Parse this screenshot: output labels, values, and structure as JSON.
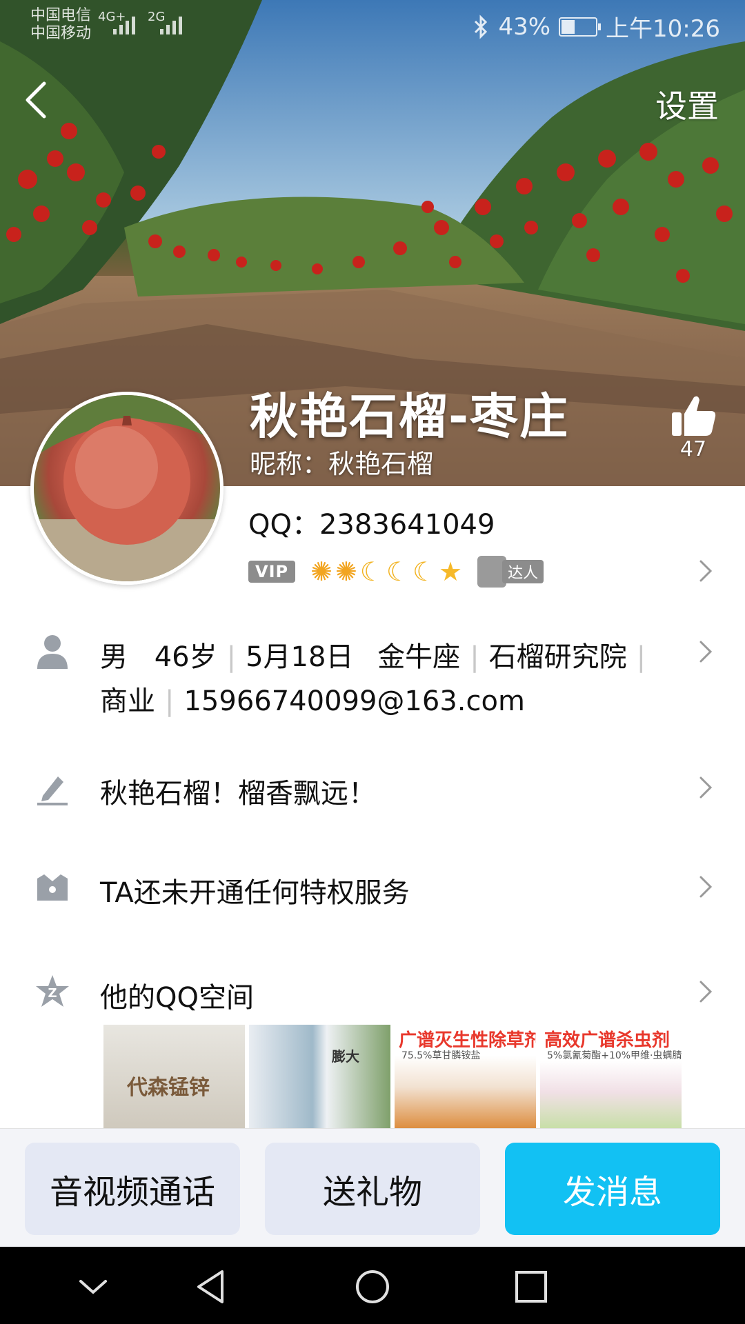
{
  "status_bar": {
    "carrier_1": "中国电信",
    "carrier_2": "中国移动",
    "net_1": "4G+",
    "net_2": "2G",
    "battery_text": "43%",
    "battery_level": 0.43,
    "time": "上午10:26"
  },
  "header": {
    "settings_label": "设置",
    "name": "秋艳石榴-枣庄",
    "nickname": "昵称：秋艳石榴",
    "like_count": "47"
  },
  "profile": {
    "qq": "QQ：2383641049",
    "vip_label": "VIP",
    "daren_label": "达人"
  },
  "details": {
    "gender": "男",
    "age": "46岁",
    "birthday": "5月18日",
    "zodiac": "金牛座",
    "company": "石榴研究院",
    "industry": "商业",
    "email": "15966740099@163.com"
  },
  "signature": "秋艳石榴！榴香飘远！",
  "privilege": "TA还未开通任何特权服务",
  "qzone": {
    "label": "他的QQ空间",
    "photos": [
      {
        "caption": "代森锰锌"
      },
      {
        "caption": "膨大"
      },
      {
        "caption": "广谱灭生性除草剂",
        "sub": "75.5%草甘膦铵盐"
      },
      {
        "caption": "高效广谱杀虫剂",
        "sub": "5%氯氰菊酯+10%甲维·虫螨腈"
      }
    ]
  },
  "actions": {
    "call": "音视频通话",
    "gift": "送礼物",
    "message": "发消息"
  },
  "colors": {
    "accent": "#12c1f3",
    "button_grey": "#e4e8f4"
  }
}
